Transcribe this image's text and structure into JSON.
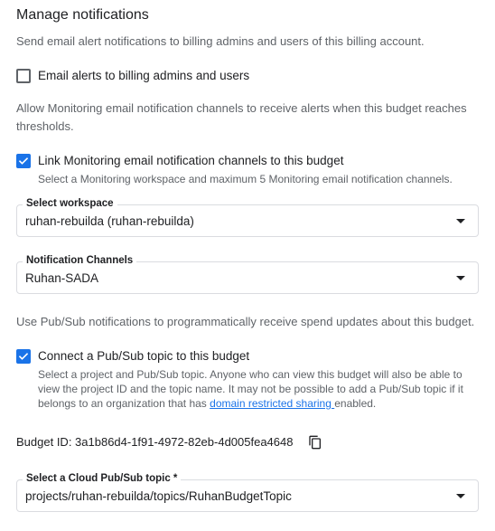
{
  "heading": "Manage notifications",
  "email_section": {
    "description": "Send email alert notifications to billing admins and users of this billing account.",
    "checkbox_label": "Email alerts to billing admins and users",
    "checked": false
  },
  "monitoring_section": {
    "description": "Allow Monitoring email notification channels to receive alerts when this budget reaches thresholds.",
    "checkbox_label": "Link Monitoring email notification channels to this budget",
    "checkbox_sub": "Select a Monitoring workspace and maximum 5 Monitoring email notification channels.",
    "checked": true,
    "workspace_label": "Select workspace",
    "workspace_value": "ruhan-rebuilda (ruhan-rebuilda)",
    "channels_label": "Notification Channels",
    "channels_value": "Ruhan-SADA"
  },
  "pubsub_section": {
    "description": "Use Pub/Sub notifications to programmatically receive spend updates about this budget.",
    "checkbox_label": "Connect a Pub/Sub topic to this budget",
    "checked": true,
    "sub_part1": "Select a project and Pub/Sub topic. Anyone who can view this budget will also be able to view the project ID and the topic name. It may not be possible to add a Pub/Sub topic if it belongs to an organization that has ",
    "sub_link": "domain restricted sharing ",
    "sub_part2": "enabled.",
    "budget_id": "Budget ID: 3a1b86d4-1f91-4972-82eb-4d005fea4648",
    "copy_icon": "copy-icon",
    "topic_label": "Select a Cloud Pub/Sub topic *",
    "topic_value": "projects/ruhan-rebuilda/topics/RuhanBudgetTopic"
  },
  "colors": {
    "accent": "#1a73e8",
    "text": "#202124",
    "secondary_text": "#5f6368",
    "border": "#dadce0"
  }
}
